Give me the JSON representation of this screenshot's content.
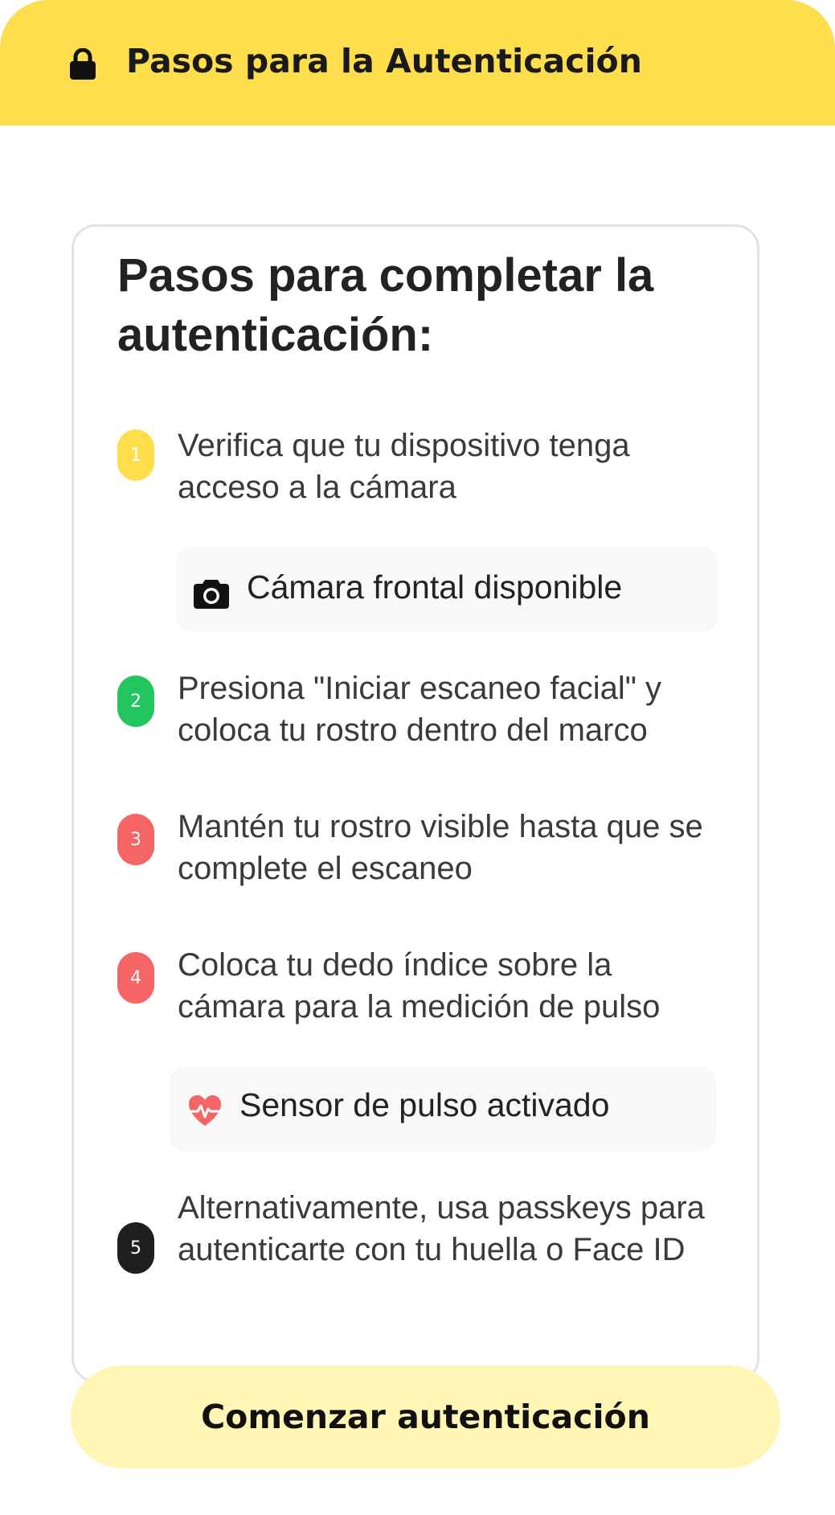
{
  "header": {
    "title": "Pasos para la Autenticación",
    "icon": "lock-icon",
    "background": "#FFDE4D"
  },
  "card": {
    "title": "Pasos para completar la autenticación:"
  },
  "steps": [
    {
      "number": "1",
      "text": "Verifica que tu dispositivo tenga acceso a la cámara",
      "color": "#FFDE4D"
    },
    {
      "number": "2",
      "text": "Presiona \"Iniciar escaneo facial\" y coloca tu rostro dentro del marco",
      "color": "#22C55E"
    },
    {
      "number": "3",
      "text": "Mantén tu rostro visible hasta que se complete el escaneo",
      "color": "#F56565"
    },
    {
      "number": "4",
      "text": "Coloca tu dedo índice sobre la cámara para la medición de pulso",
      "color": "#F56565"
    },
    {
      "number": "5",
      "text": "Alternativamente, usa passkeys para autenticarte con tu huella o Face ID",
      "color": "#1F1F1F"
    }
  ],
  "status": {
    "camera": {
      "label": "Cámara frontal disponible",
      "icon": "camera-icon"
    },
    "pulse": {
      "label": "Sensor de pulso activado",
      "icon": "heart-pulse-icon",
      "color": "#F56565"
    }
  },
  "cta": {
    "label": "Comenzar autenticación",
    "background": "#FFF5B5"
  }
}
